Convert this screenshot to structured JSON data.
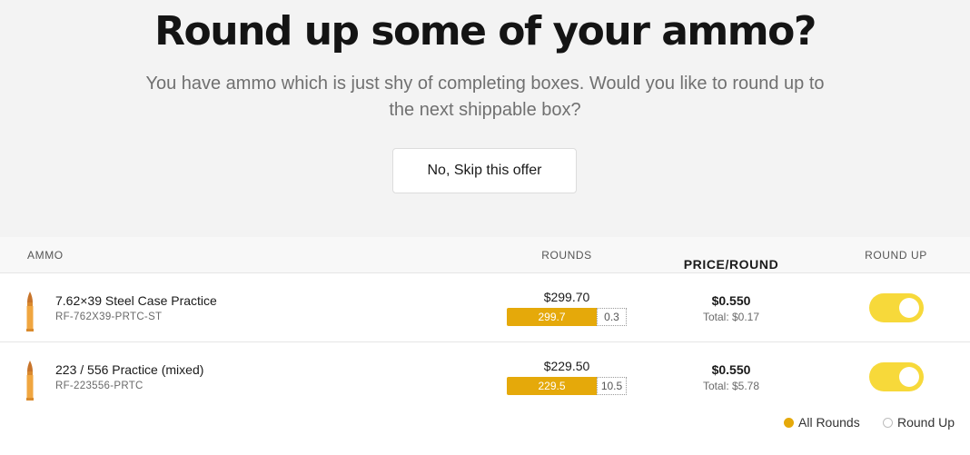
{
  "header": {
    "title": "Round up some of your ammo?",
    "subtitle": "You have ammo which is just shy of completing boxes. Would you like to round up to the next shippable box?",
    "skip_label": "No, Skip this offer"
  },
  "table": {
    "columns": [
      "AMMO",
      "ROUNDS",
      "PRICE/ROUND",
      "ROUND UP"
    ],
    "rows": [
      {
        "name": "7.62×39 Steel Case Practice",
        "sku": "RF-762X39-PRTC-ST",
        "rounds_total": "$299.70",
        "bar_filled": "299.7",
        "bar_remaining": "0.3",
        "price": "$0.550",
        "price_total": "Total: $0.17",
        "round_up": true
      },
      {
        "name": "223 / 556 Practice (mixed)",
        "sku": "RF-223556-PRTC",
        "rounds_total": "$229.50",
        "bar_filled": "229.5",
        "bar_remaining": "10.5",
        "price": "$0.550",
        "price_total": "Total: $5.78",
        "round_up": true
      }
    ]
  },
  "legend": {
    "all_rounds": "All Rounds",
    "round_up": "Round Up"
  },
  "colors": {
    "accent": "#e5a90a",
    "toggle_on": "#f7d93a",
    "hero_bg": "#f3f3f3"
  },
  "icons": [
    "bullet-icon"
  ]
}
